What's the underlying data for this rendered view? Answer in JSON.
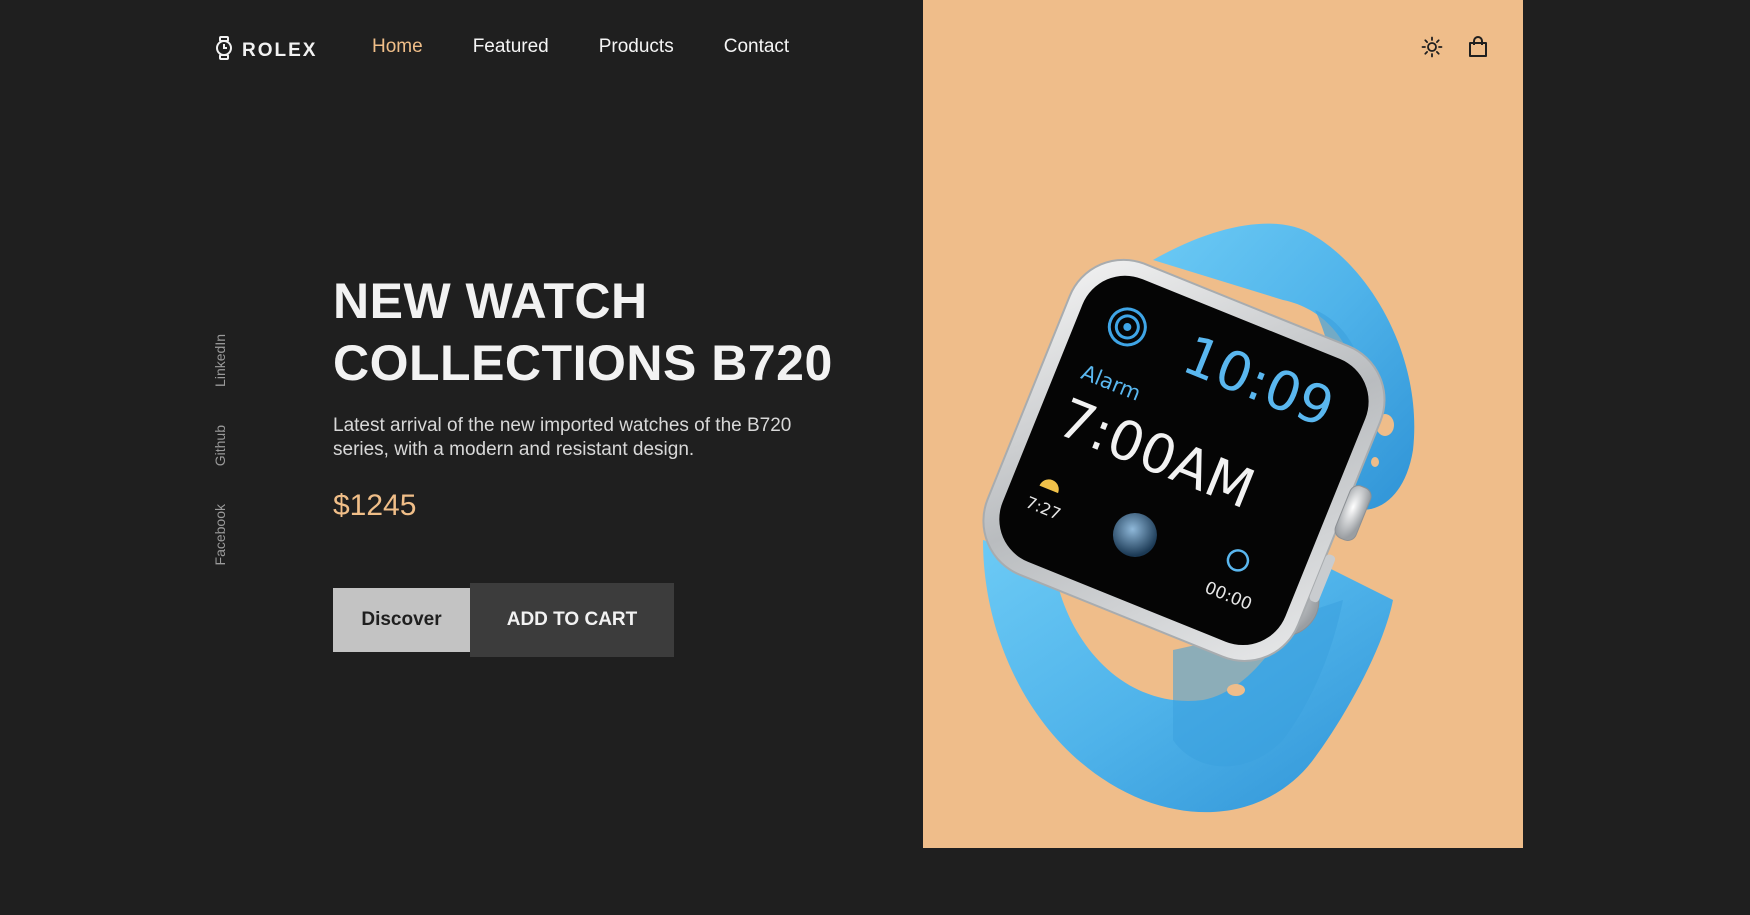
{
  "brand": {
    "name": "ROLEX",
    "icon": "watch-icon"
  },
  "nav": [
    {
      "label": "Home",
      "active": true
    },
    {
      "label": "Featured",
      "active": false
    },
    {
      "label": "Products",
      "active": false
    },
    {
      "label": "Contact",
      "active": false
    }
  ],
  "header_icons": [
    "sun-icon",
    "shopping-bag-icon"
  ],
  "social": [
    "LinkedIn",
    "Github",
    "Facebook"
  ],
  "hero": {
    "title_line1": "NEW WATCH",
    "title_line2": "COLLECTIONS B720",
    "description": "Latest arrival of the new imported watches of the B720 series, with a modern and resistant design.",
    "price": "$1245"
  },
  "buttons": {
    "discover": "Discover",
    "add_to_cart": "ADD TO CART"
  },
  "watch_screen": {
    "time": "10:09",
    "alarm_label": "Alarm",
    "alarm_time": "7:00AM",
    "sunrise": "7:27",
    "timer": "00:00"
  },
  "colors": {
    "background": "#1f1f1f",
    "accent": "#f0be88",
    "panel": "#efbd8a",
    "strap": "#4fb3ea"
  }
}
